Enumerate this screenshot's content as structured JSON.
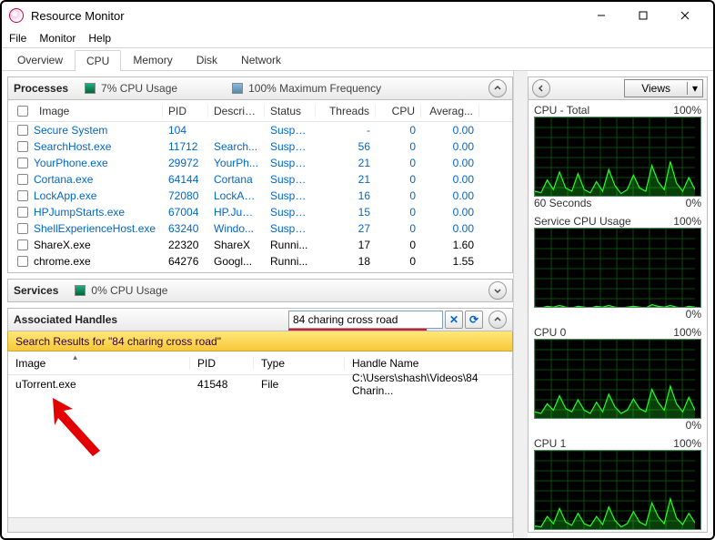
{
  "window": {
    "title": "Resource Monitor"
  },
  "menu": {
    "file": "File",
    "monitor": "Monitor",
    "help": "Help"
  },
  "tabs": {
    "overview": "Overview",
    "cpu": "CPU",
    "memory": "Memory",
    "disk": "Disk",
    "network": "Network"
  },
  "processes": {
    "title": "Processes",
    "usage_label": "7% CPU Usage",
    "freq_label": "100% Maximum Frequency",
    "cols": {
      "image": "Image",
      "pid": "PID",
      "descrip": "Descrip...",
      "status": "Status",
      "threads": "Threads",
      "cpu": "CPU",
      "avg": "Averag..."
    },
    "rows": [
      {
        "img": "Secure System",
        "pid": "104",
        "desc": "",
        "status": "Suspe...",
        "threads": "-",
        "cpu": "0",
        "avg": "0.00",
        "link": true
      },
      {
        "img": "SearchHost.exe",
        "pid": "11712",
        "desc": "Search...",
        "status": "Suspe...",
        "threads": "56",
        "cpu": "0",
        "avg": "0.00",
        "link": true
      },
      {
        "img": "YourPhone.exe",
        "pid": "29972",
        "desc": "YourPh...",
        "status": "Suspe...",
        "threads": "21",
        "cpu": "0",
        "avg": "0.00",
        "link": true
      },
      {
        "img": "Cortana.exe",
        "pid": "64144",
        "desc": "Cortana",
        "status": "Suspe...",
        "threads": "21",
        "cpu": "0",
        "avg": "0.00",
        "link": true
      },
      {
        "img": "LockApp.exe",
        "pid": "72080",
        "desc": "LockAp...",
        "status": "Suspe...",
        "threads": "16",
        "cpu": "0",
        "avg": "0.00",
        "link": true
      },
      {
        "img": "HPJumpStarts.exe",
        "pid": "67004",
        "desc": "HP.Jum...",
        "status": "Suspe...",
        "threads": "15",
        "cpu": "0",
        "avg": "0.00",
        "link": true
      },
      {
        "img": "ShellExperienceHost.exe",
        "pid": "63240",
        "desc": "Windo...",
        "status": "Suspe...",
        "threads": "27",
        "cpu": "0",
        "avg": "0.00",
        "link": true
      },
      {
        "img": "ShareX.exe",
        "pid": "22320",
        "desc": "ShareX",
        "status": "Runni...",
        "threads": "17",
        "cpu": "0",
        "avg": "1.60",
        "link": false
      },
      {
        "img": "chrome.exe",
        "pid": "64276",
        "desc": "Googl...",
        "status": "Runni...",
        "threads": "18",
        "cpu": "0",
        "avg": "1.55",
        "link": false
      }
    ]
  },
  "services": {
    "title": "Services",
    "usage_label": "0% CPU Usage"
  },
  "handles": {
    "title": "Associated Handles",
    "search_value": "84 charing cross road",
    "results_label": "Search Results for \"84 charing cross road\"",
    "cols": {
      "image": "Image",
      "pid": "PID",
      "type": "Type",
      "name": "Handle Name"
    },
    "rows": [
      {
        "img": "uTorrent.exe",
        "pid": "41548",
        "type": "File",
        "name": "C:\\Users\\shash\\Videos\\84 Charin..."
      }
    ]
  },
  "rightpanel": {
    "views": "Views",
    "graphs": [
      {
        "title": "CPU - Total",
        "pct": "100%",
        "foot_l": "60 Seconds",
        "foot_r": "0%"
      },
      {
        "title": "Service CPU Usage",
        "pct": "100%",
        "foot_l": "",
        "foot_r": "0%"
      },
      {
        "title": "CPU 0",
        "pct": "100%",
        "foot_l": "",
        "foot_r": "0%"
      },
      {
        "title": "CPU 1",
        "pct": "100%",
        "foot_l": "",
        "foot_r": ""
      }
    ]
  },
  "chart_data": [
    {
      "type": "area",
      "title": "CPU - Total",
      "ylim": [
        0,
        100
      ],
      "xlabel": "60 Seconds",
      "series": [
        {
          "name": "cpu",
          "values": [
            8,
            6,
            22,
            10,
            32,
            12,
            8,
            30,
            10,
            6,
            20,
            8,
            35,
            15,
            5,
            10,
            28,
            12,
            8,
            40,
            20,
            10,
            45,
            18,
            8,
            25,
            10
          ]
        }
      ]
    },
    {
      "type": "area",
      "title": "Service CPU Usage",
      "ylim": [
        0,
        100
      ],
      "series": [
        {
          "name": "svc",
          "values": [
            2,
            1,
            3,
            2,
            4,
            2,
            1,
            3,
            2,
            1,
            3,
            2,
            4,
            2,
            1,
            2,
            3,
            2,
            1,
            5,
            3,
            2,
            4,
            2,
            1,
            3,
            2
          ]
        }
      ]
    },
    {
      "type": "area",
      "title": "CPU 0",
      "ylim": [
        0,
        100
      ],
      "series": [
        {
          "name": "c0",
          "values": [
            10,
            8,
            20,
            12,
            30,
            14,
            10,
            25,
            12,
            8,
            22,
            10,
            32,
            16,
            8,
            12,
            26,
            14,
            10,
            38,
            22,
            12,
            42,
            20,
            10,
            28,
            12
          ]
        }
      ]
    },
    {
      "type": "area",
      "title": "CPU 1",
      "ylim": [
        0,
        100
      ],
      "series": [
        {
          "name": "c1",
          "values": [
            6,
            5,
            18,
            9,
            28,
            11,
            7,
            22,
            9,
            6,
            18,
            8,
            30,
            13,
            5,
            9,
            24,
            11,
            7,
            35,
            18,
            9,
            40,
            16,
            8,
            22,
            10
          ]
        }
      ]
    }
  ]
}
